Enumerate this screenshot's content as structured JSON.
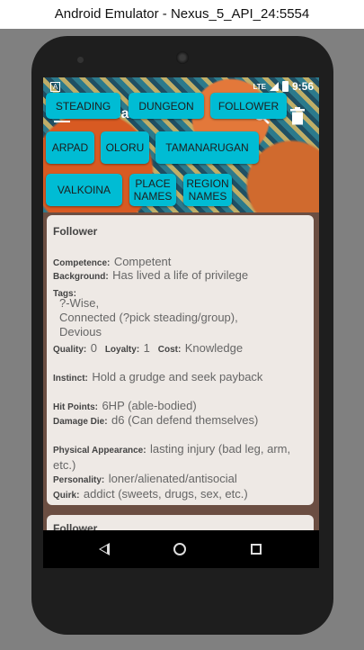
{
  "window": {
    "title": "Android Emulator - Nexus_5_API_24:5554"
  },
  "status": {
    "time": "9:56",
    "network": "LTE",
    "left_icon": "A"
  },
  "appbar": {
    "title": "Create & Name"
  },
  "buttons": [
    "STEADING",
    "DUNGEON",
    "FOLLOWER",
    "ARPAD",
    "OLORU",
    "TAMANARUGAN",
    "VALKOINA",
    "PLACE NAMES",
    "REGION NAMES"
  ],
  "card": {
    "title": "Follower",
    "competence_label": "Competence:",
    "competence": "Competent",
    "background_label": "Background:",
    "background": "Has lived a life of privilege",
    "tags_label": "Tags:",
    "tags": [
      "?-Wise,",
      "Connected (?pick steading/group),",
      "Devious"
    ],
    "quality_label": "Quality:",
    "quality": "0",
    "loyalty_label": "Loyalty:",
    "loyalty": "1",
    "cost_label": "Cost:",
    "cost": "Knowledge",
    "instinct_label": "Instinct:",
    "instinct": "Hold a grudge and seek payback",
    "hp_label": "Hit Points:",
    "hp": "6HP (able-bodied)",
    "damage_label": "Damage Die:",
    "damage": "d6 (Can defend themselves)",
    "appearance_label": "Physical Appearance:",
    "appearance": "lasting injury (bad leg, arm, etc.)",
    "personality_label": "Personality:",
    "personality": "loner/alienated/antisocial",
    "quirk_label": "Quirk:",
    "quirk": "addict (sweets, drugs, sex, etc.)"
  },
  "card2": {
    "title": "Follower"
  }
}
